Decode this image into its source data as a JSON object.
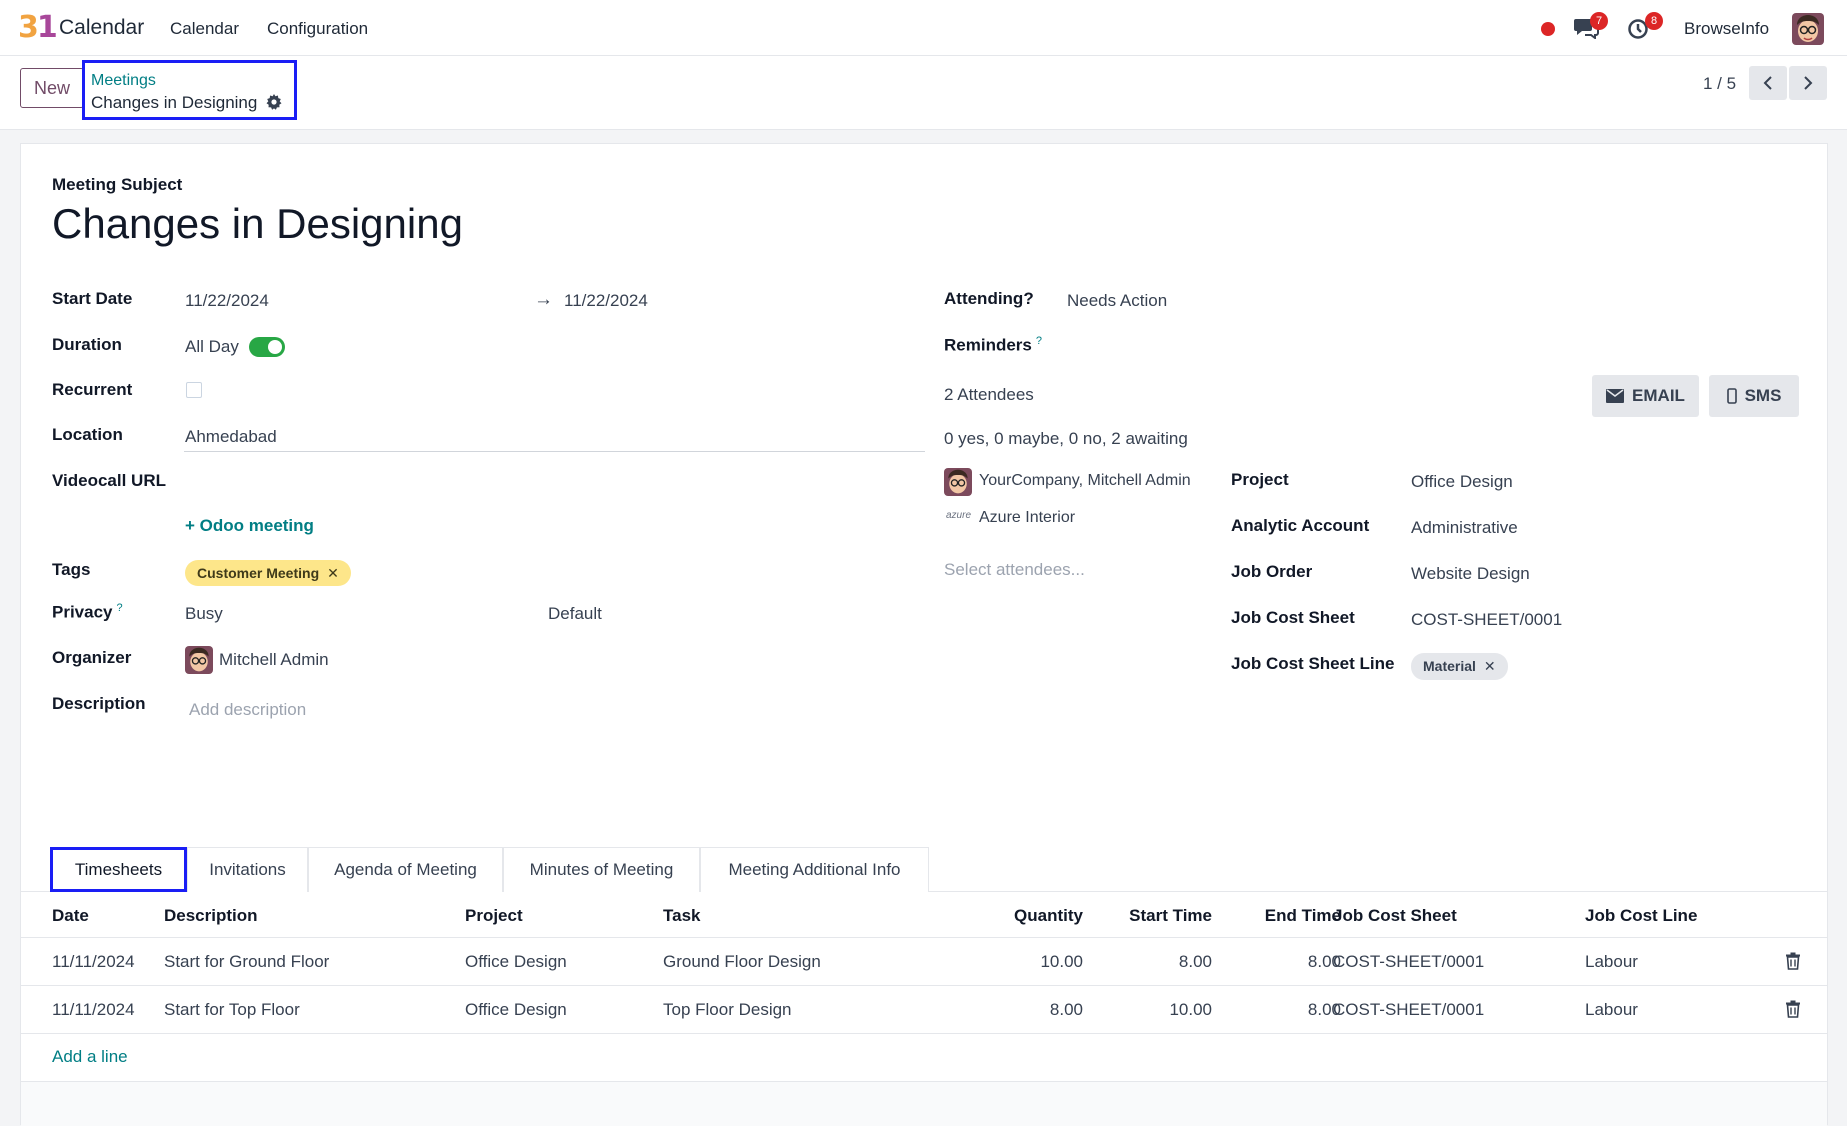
{
  "navbar": {
    "logo_digit_3": "3",
    "logo_digit_1": "1",
    "app_name": "Calendar",
    "menus": [
      "Calendar",
      "Configuration"
    ],
    "messages_count": "7",
    "activities_count": "8",
    "user_name": "BrowseInfo"
  },
  "control": {
    "new_label": "New",
    "breadcrumb_parent": "Meetings",
    "breadcrumb_current": "Changes in Designing",
    "pager": "1 / 5"
  },
  "form": {
    "subject_label": "Meeting Subject",
    "subject": "Changes in Designing",
    "start_date_label": "Start Date",
    "start_date": "11/22/2024",
    "arrow": "→",
    "end_date": "11/22/2024",
    "duration_label": "Duration",
    "all_day_label": "All Day",
    "all_day": true,
    "recurrent_label": "Recurrent",
    "location_label": "Location",
    "location": "Ahmedabad",
    "videocall_label": "Videocall URL",
    "odoo_meeting": "+ Odoo meeting",
    "tags_label": "Tags",
    "tag": "Customer Meeting",
    "tag_remove": "✕",
    "privacy_label": "Privacy",
    "privacy_help": "?",
    "privacy_show_as": "Busy",
    "privacy_value": "Default",
    "organizer_label": "Organizer",
    "organizer": "Mitchell Admin",
    "description_label": "Description",
    "description_placeholder": "Add description",
    "attending_label": "Attending?",
    "attending": "Needs Action",
    "reminders_label": "Reminders",
    "reminders_help": "?",
    "attendees_count": "2 Attendees",
    "attendees_summary": "0 yes, 0 maybe, 0 no, 2 awaiting",
    "attendees": [
      "YourCompany, Mitchell Admin",
      "Azure Interior"
    ],
    "azure_logo_text": "azure",
    "select_attendees": "Select attendees...",
    "email_btn": "EMAIL",
    "sms_btn": "SMS",
    "project_label": "Project",
    "project": "Office Design",
    "analytic_label": "Analytic Account",
    "analytic": "Administrative",
    "job_order_label": "Job Order",
    "job_order": "Website Design",
    "job_cost_sheet_label": "Job Cost Sheet",
    "job_cost_sheet": "COST-SHEET/0001",
    "job_cost_sheet_line_label": "Job Cost Sheet Line",
    "job_cost_sheet_line": "Material",
    "job_cost_sheet_line_remove": "✕"
  },
  "tabs": [
    "Timesheets",
    "Invitations",
    "Agenda of Meeting",
    "Minutes of Meeting",
    "Meeting Additional Info"
  ],
  "table": {
    "headers": [
      "Date",
      "Description",
      "Project",
      "Task",
      "Quantity",
      "Start Time",
      "End Time",
      "Job Cost Sheet",
      "Job Cost Line"
    ],
    "rows": [
      [
        "11/11/2024",
        "Start for Ground Floor",
        "Office Design",
        "Ground Floor Design",
        "10.00",
        "8.00",
        "8.00",
        "COST-SHEET/0001",
        "Labour"
      ],
      [
        "11/11/2024",
        "Start for Top Floor",
        "Office Design",
        "Top Floor Design",
        "8.00",
        "10.00",
        "8.00",
        "COST-SHEET/0001",
        "Labour"
      ]
    ],
    "add_line": "Add a line"
  },
  "colors": {
    "brand": "#714b67",
    "link": "#017e84",
    "highlight_box": "#1a1ef5",
    "badge": "#dc2626",
    "toggle_on": "#28a745",
    "tag_yellow": "#fde68a"
  }
}
